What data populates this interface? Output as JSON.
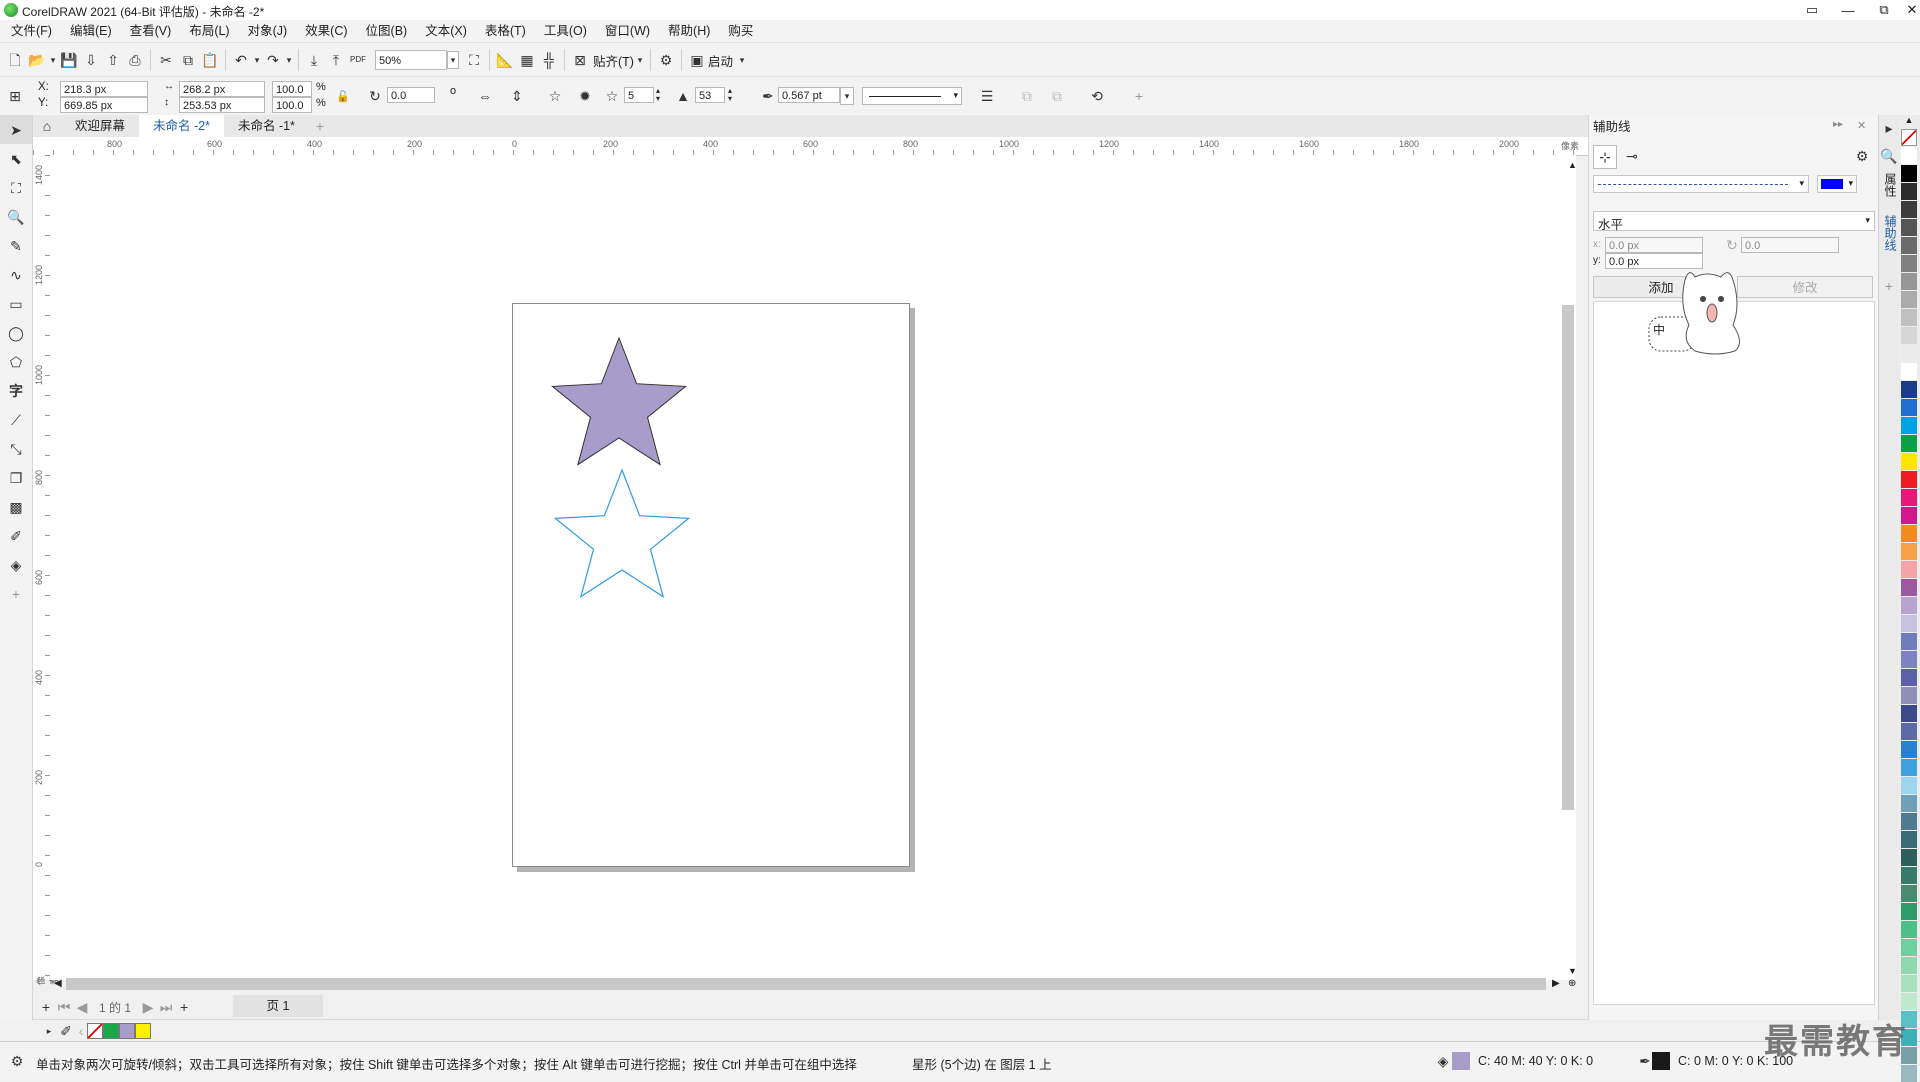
{
  "app": {
    "title": "CorelDRAW 2021 (64-Bit 评估版) - 未命名 -2*"
  },
  "window_controls": [
    "▭",
    "—",
    "⧉",
    "✕"
  ],
  "menu": [
    "文件(F)",
    "编辑(E)",
    "查看(V)",
    "布局(L)",
    "对象(J)",
    "效果(C)",
    "位图(B)",
    "文本(X)",
    "表格(T)",
    "工具(O)",
    "窗口(W)",
    "帮助(H)",
    "购买"
  ],
  "toolbar1": {
    "zoom": "50%",
    "snap_label": "贴齐(T)",
    "launch_label": "启动",
    "pdf_label": "PDF"
  },
  "props": {
    "x_label": "X:",
    "y_label": "Y:",
    "x": "218.3 px",
    "y": "669.85 px",
    "w": "268.2 px",
    "h": "253.53 px",
    "sx": "100.0",
    "sy": "100.0",
    "pct": "%",
    "rotation": "0.0",
    "deg": "o",
    "points": "5",
    "sharpness": "53",
    "outline": "0.567 pt"
  },
  "tabs": [
    {
      "label": "欢迎屏幕",
      "active": false
    },
    {
      "label": "未命名 -2*",
      "active": true
    },
    {
      "label": "未命名 -1*",
      "active": false
    }
  ],
  "ruler": {
    "h_labels": [
      "800",
      "600",
      "400",
      "200",
      "0",
      "200",
      "400",
      "600",
      "800",
      "1000",
      "1200",
      "1400",
      "1600",
      "1800",
      "2000"
    ],
    "h_unit": "像素",
    "v_labels": [
      "1400",
      "1200",
      "1000",
      "800",
      "600",
      "400",
      "200",
      "0"
    ],
    "v_unit": "像素"
  },
  "shapes": {
    "filled_star": {
      "fill": "#a89ccb",
      "stroke": "#333333"
    },
    "outline_star": {
      "fill": "none",
      "stroke": "#2e9be0"
    }
  },
  "pagenav": {
    "counter": "1 的 1",
    "page_tab": "页 1"
  },
  "doc_palette": [
    "#18a84a",
    "#a89ccb",
    "#ffee00"
  ],
  "status": {
    "hint": "单击对象两次可旋转/倾斜；双击工具可选择所有对象；按住 Shift 键单击可选择多个对象；按住 Alt 键单击可进行挖掘；按住 Ctrl 并单击可在组中选择",
    "object_info": "星形 (5个边) 在 图层 1 上",
    "fill_swatch": "#a89ccb",
    "fill_values": "C: 40 M: 40 Y: 0 K: 0",
    "outline_swatch": "#1a1a1a",
    "outline_values": "C: 0 M: 0 Y: 0 K: 100"
  },
  "docker": {
    "title": "辅助线",
    "guide_color": "#0000ff",
    "orientation": "水平",
    "x_value": "0.0 px",
    "y_value": "0.0 px",
    "x_label": "x:",
    "y_label": "y:",
    "angle_value": "0.0",
    "add_label": "添加",
    "modify_label": "修改",
    "side_tabs": [
      "属性",
      "辅助线"
    ]
  },
  "overlay": {
    "sticker_text": "中",
    "watermark": "最需教育"
  },
  "palette": [
    "#ffffff",
    "#000000",
    "#2b2b2b",
    "#3d3d3d",
    "#545454",
    "#6b6b6b",
    "#808080",
    "#969696",
    "#ababab",
    "#c0c0c0",
    "#d6d6d6",
    "#ebebeb",
    "#ffffff",
    "#1a3c8a",
    "#1e6fd0",
    "#00a0e6",
    "#0a9f4a",
    "#ffe600",
    "#ee1c25",
    "#e6197a",
    "#d2188c",
    "#f28c1e",
    "#f6a04a",
    "#f5a3a8",
    "#9a5aa0",
    "#b7a4d0",
    "#c8c0e0",
    "#6f7dbf",
    "#7c82c2",
    "#5a5fa8",
    "#8f8fb8",
    "#3c4a8a",
    "#5c6aa8",
    "#2a7fd0",
    "#3fa0e0",
    "#9fd4ef",
    "#6fa0b8",
    "#507a90",
    "#3a6a78",
    "#2e5f5a",
    "#3a7a6a",
    "#4a8a70",
    "#2f9a6a",
    "#4fbf8a",
    "#6fcfa0",
    "#8fd8b0",
    "#a8e0c0",
    "#c0e8cf",
    "#5ac0c8",
    "#40b0b8",
    "#7a9fa8",
    "#9ab8c0"
  ]
}
